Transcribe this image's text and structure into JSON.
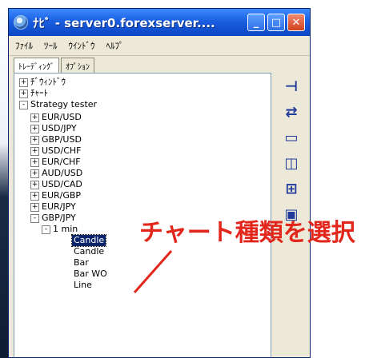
{
  "window": {
    "title": "ﾅﾋﾞ - server0.forexserver....",
    "menu": [
      "ﾌｧｲﾙ",
      "ﾂｰﾙ",
      "ｳｲﾝﾄﾞｳ",
      "ﾍﾙﾌﾟ"
    ],
    "tabs": [
      "ﾄﾚｰﾃﾞｨﾝｸﾞ",
      "ｵﾌﾟｼｮﾝ"
    ]
  },
  "tree": {
    "root1": "ﾁﾞｳｨﾝﾄﾞｳ",
    "root2": "ﾁｬｰﾄ",
    "root3": "Strategy tester",
    "pairs": [
      "EUR/USD",
      "USD/JPY",
      "GBP/USD",
      "USD/CHF",
      "EUR/CHF",
      "AUD/USD",
      "USD/CAD",
      "EUR/GBP",
      "EUR/JPY",
      "GBP/JPY"
    ],
    "timeframe": "1 min",
    "chart_types": [
      "Candle",
      "Candle",
      "Bar",
      "Bar WO",
      "Line"
    ]
  },
  "annotation": {
    "text": "チャート種類を選択",
    "color": "#e3261b"
  }
}
